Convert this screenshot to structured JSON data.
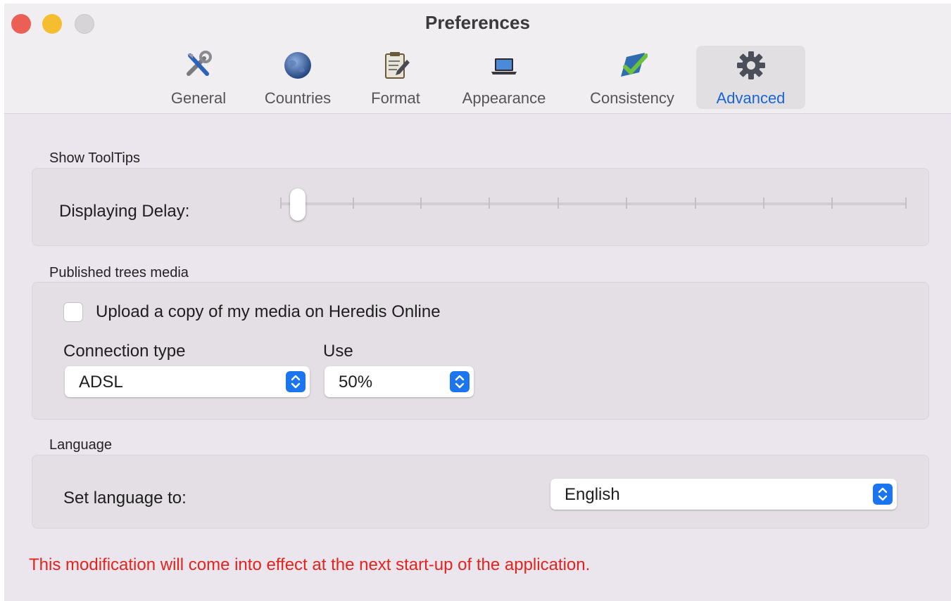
{
  "window": {
    "title": "Preferences"
  },
  "toolbar": {
    "tabs": [
      {
        "label": "General",
        "icon": "tools-icon"
      },
      {
        "label": "Countries",
        "icon": "globe-icon"
      },
      {
        "label": "Format",
        "icon": "notepad-icon"
      },
      {
        "label": "Appearance",
        "icon": "laptop-icon"
      },
      {
        "label": "Consistency",
        "icon": "checkmark-icon"
      },
      {
        "label": "Advanced",
        "icon": "gear-icon",
        "selected": true
      }
    ]
  },
  "tooltips": {
    "section_label": "Show ToolTips",
    "delay_label": "Displaying Delay:",
    "delay_value_fraction": 0.03
  },
  "media": {
    "section_label": "Published trees media",
    "upload_label": "Upload a copy of my media on Heredis Online",
    "upload_checked": false,
    "connection_label": "Connection type",
    "connection_value": "ADSL",
    "use_label": "Use",
    "use_value": "50%"
  },
  "language": {
    "section_label": "Language",
    "set_label": "Set language to:",
    "value": "English"
  },
  "warning": "This modification will come into effect at the next start-up of the application.",
  "colors": {
    "accent": "#1b75ef",
    "selected_tab_text": "#1a64d6",
    "warning": "#e3231c"
  }
}
